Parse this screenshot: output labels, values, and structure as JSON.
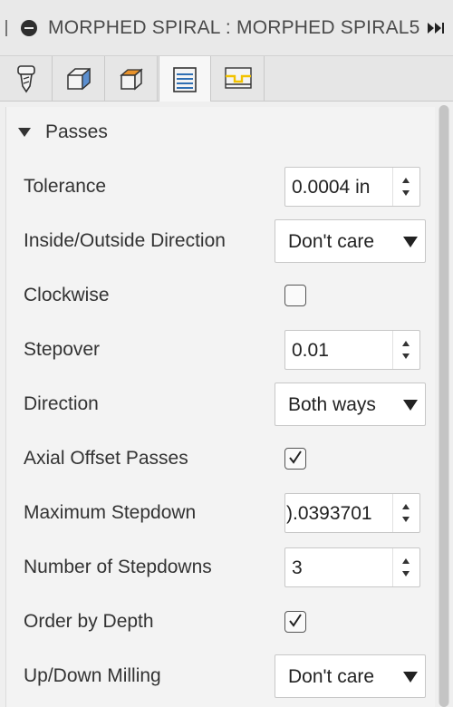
{
  "window": {
    "title": "MORPHED SPIRAL : MORPHED SPIRAL5"
  },
  "tabs": [
    {
      "name": "tool-tab",
      "icon": "tool-icon",
      "active": false
    },
    {
      "name": "geometry-tab",
      "icon": "geometry-icon",
      "active": false
    },
    {
      "name": "heights-tab",
      "icon": "heights-icon",
      "active": false
    },
    {
      "name": "passes-tab",
      "icon": "passes-icon",
      "active": true
    },
    {
      "name": "linking-tab",
      "icon": "linking-icon",
      "active": false
    }
  ],
  "section": {
    "title": "Passes"
  },
  "fields": {
    "tolerance": {
      "label": "Tolerance",
      "value": "0.0004 in"
    },
    "inside_outside": {
      "label": "Inside/Outside Direction",
      "value": "Don't care"
    },
    "clockwise": {
      "label": "Clockwise",
      "checked": false
    },
    "stepover": {
      "label": "Stepover",
      "value": "0.01"
    },
    "direction": {
      "label": "Direction",
      "value": "Both ways"
    },
    "axial_offset": {
      "label": "Axial Offset Passes",
      "checked": true
    },
    "max_stepdown": {
      "label": "Maximum Stepdown",
      "value": ").0393701"
    },
    "num_stepdowns": {
      "label": "Number of Stepdowns",
      "value": "3"
    },
    "order_by_depth": {
      "label": "Order by Depth",
      "checked": true
    },
    "up_down_milling": {
      "label": "Up/Down Milling",
      "value": "Don't care"
    }
  },
  "colors": {
    "accent_orange": "#e8922b",
    "accent_blue": "#2f6fb3",
    "accent_yellow": "#f2c200"
  }
}
